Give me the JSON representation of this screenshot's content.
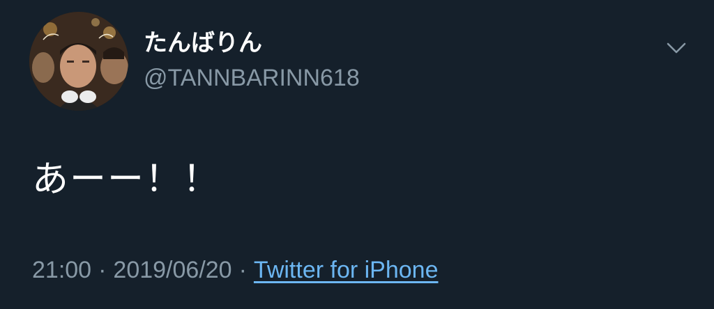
{
  "tweet": {
    "author": {
      "display_name": "たんばりん",
      "handle": "@TANNBARINN618"
    },
    "text": "あーー！！",
    "time": "21:00",
    "separator": "·",
    "date": "2019/06/20",
    "source": "Twitter for iPhone"
  },
  "icons": {
    "more": "chevron-down-icon",
    "avatar": "avatar-photo"
  },
  "colors": {
    "background": "#15202b",
    "primary_text": "#ffffff",
    "secondary_text": "#8899a6",
    "link": "#6cb6f2"
  }
}
